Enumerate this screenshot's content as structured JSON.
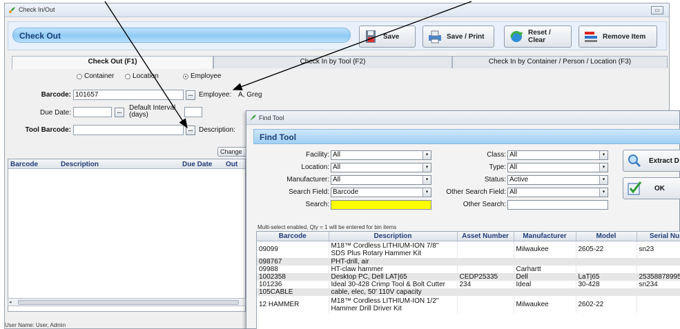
{
  "window": {
    "title": "Check In/Out",
    "minimize": "▭"
  },
  "header": {
    "title": "Check Out",
    "buttons": {
      "save": "Save",
      "save_print": "Save / Print",
      "reset": "Reset / Clear",
      "remove": "Remove Item"
    }
  },
  "tabs": [
    "Check Out (F1)",
    "Check In by Tool (F2)",
    "Check In by Container / Person / Location (F3)"
  ],
  "checkout": {
    "radio": {
      "container": "Container",
      "location": "Location",
      "employee": "Employee",
      "selected": "employee"
    },
    "barcode_label": "Barcode:",
    "barcode_value": "101657",
    "employee_label": "Employee:",
    "employee_value": "A, Greg",
    "due_date_label": "Due Date:",
    "default_interval_label": "Default Interval\n(days)",
    "tool_barcode_label": "Tool Barcode:",
    "description_label": "Description:",
    "change_label": "Change",
    "ellipsis": "...",
    "grid_columns": [
      "Barcode",
      "Description",
      "Due Date",
      "Out"
    ]
  },
  "status": {
    "user": "User Name:  User, Admin"
  },
  "find_tool": {
    "window_title": "Find Tool",
    "heading": "Find Tool",
    "filters": {
      "facility": {
        "label": "Facility:",
        "value": "All"
      },
      "location": {
        "label": "Location:",
        "value": "All"
      },
      "manufacturer": {
        "label": "Manufacturer:",
        "value": "All"
      },
      "search_field": {
        "label": "Search Field:",
        "value": "Barcode"
      },
      "search": {
        "label": "Search:",
        "value": ""
      },
      "class": {
        "label": "Class:",
        "value": "All"
      },
      "type": {
        "label": "Type:",
        "value": "All"
      },
      "status": {
        "label": "Status:",
        "value": "Active"
      },
      "other_search_field": {
        "label": "Other Search Field:",
        "value": "All"
      },
      "other_search": {
        "label": "Other Search:",
        "value": ""
      }
    },
    "buttons": {
      "extract": "Extract D",
      "ok": "OK"
    },
    "note": "Multi-select enabled, Qty = 1 will be entered for bin items",
    "columns": [
      "Barcode",
      "Description",
      "Asset Number",
      "Manufacturer",
      "Model",
      "Serial Num"
    ],
    "rows": [
      {
        "barcode": "09099",
        "description": "M18™ Cordless LITHIUM-ION 7/8\"\nSDS Plus Rotary Hammer Kit",
        "asset": "",
        "manufacturer": "Milwaukee",
        "model": "2605-22",
        "serial": "sn23"
      },
      {
        "barcode": "098767",
        "description": "PHT-drill, air",
        "asset": "",
        "manufacturer": "",
        "model": "",
        "serial": ""
      },
      {
        "barcode": "09988",
        "description": "HT-claw hammer",
        "asset": "",
        "manufacturer": "Carhartt",
        "model": "",
        "serial": ""
      },
      {
        "barcode": "1002358",
        "description": "Desktop PC, Dell LAT|65",
        "asset": "CEDP25335",
        "manufacturer": "Dell",
        "model": "LaT|65",
        "serial": "25358878995"
      },
      {
        "barcode": "101236",
        "description": "Ideal 30-428 Crimp Tool & Bolt Cutter",
        "asset": "234",
        "manufacturer": "Ideal",
        "model": "30-428",
        "serial": "sn234"
      },
      {
        "barcode": "105CABLE",
        "description": "cable, elec, 50' 110V capacity",
        "asset": "",
        "manufacturer": "",
        "model": "",
        "serial": ""
      },
      {
        "barcode": "12 HAMMER",
        "description": "M18™ Cordless LITHIUM-ION 1/2\"\nHammer Drill Driver Kit",
        "asset": "",
        "manufacturer": "Milwaukee",
        "model": "2602-22",
        "serial": ""
      }
    ]
  },
  "colors": {
    "accent_blue": "#8ecbf4",
    "search_highlight": "#ffff00",
    "title_text": "#1c3f78"
  }
}
